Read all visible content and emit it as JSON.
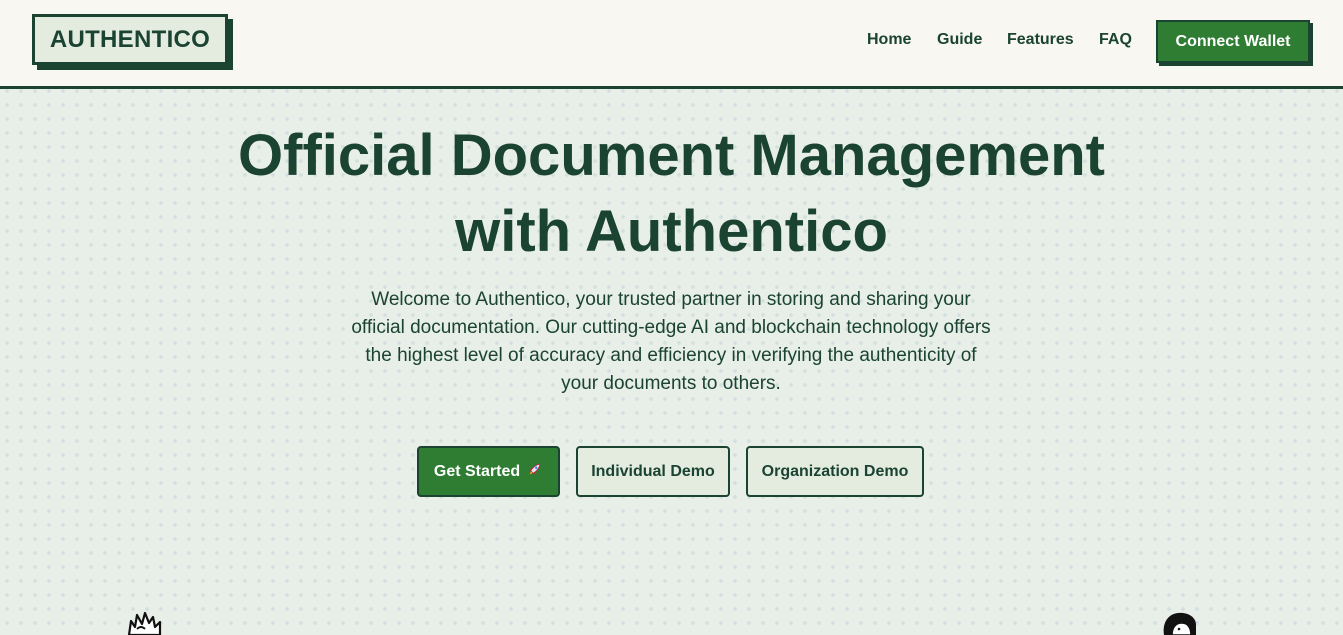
{
  "header": {
    "logo": "AUTHENTICO",
    "nav": [
      {
        "label": "Home"
      },
      {
        "label": "Guide"
      },
      {
        "label": "Features"
      },
      {
        "label": "FAQ"
      }
    ],
    "connect_label": "Connect Wallet"
  },
  "hero": {
    "title_line1": "Official Document Management",
    "title_line2": "with Authentico",
    "description": "Welcome to Authentico, your trusted partner in storing and sharing your official documentation. Our cutting-edge AI and blockchain technology offers the highest level of accuracy and efficiency in verifying the authenticity of your documents to others.",
    "buttons": {
      "get_started": "Get Started",
      "get_started_icon": "rocket-icon",
      "individual_demo": "Individual Demo",
      "organization_demo": "Organization Demo"
    }
  },
  "colors": {
    "primary_green": "#2e7d32",
    "dark_green": "#1b4332",
    "soft_green": "#e3ecdf",
    "page_background": "#e8efe9",
    "header_background": "#f8f7f2"
  }
}
